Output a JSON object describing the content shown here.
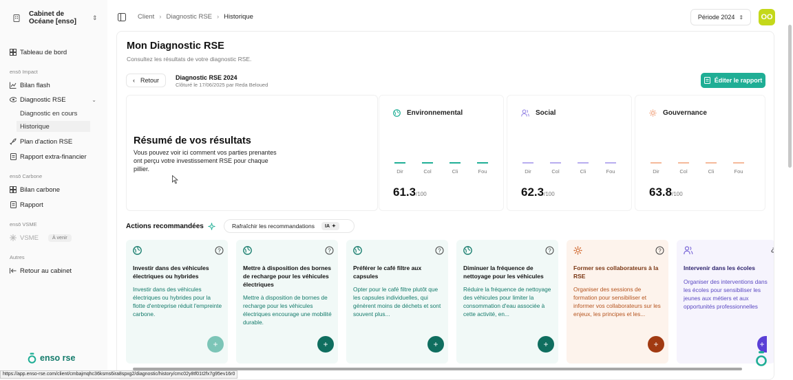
{
  "sidebar": {
    "org_name": "Cabinet de Océane [enso]",
    "items": {
      "tableau": "Tableau de bord",
      "group_impact": "ensō Impact",
      "bilan_flash": "Bilan flash",
      "diagnostic": "Diagnostic RSE",
      "diagnostic_en_cours": "Diagnostic en cours",
      "historique": "Historique",
      "plan_action": "Plan d'action RSE",
      "rapport_extra": "Rapport extra-financier",
      "group_carbone": "ensō Carbone",
      "bilan_carbone": "Bilan carbone",
      "rapport": "Rapport",
      "group_vsme": "ensō VSME",
      "vsme": "VSME",
      "a_venir": "À venir",
      "group_autres": "Autres",
      "retour_cabinet": "Retour au cabinet"
    },
    "logo_text": "enso rse"
  },
  "breadcrumb": [
    "Client",
    "Diagnostic RSE",
    "Historique"
  ],
  "period": "Période 2024",
  "avatar_initials": "OO",
  "page": {
    "title": "Mon Diagnostic RSE",
    "subtitle": "Consultez les résultats de votre diagnostic RSE.",
    "back_label": "Retour",
    "diag_title": "Diagnostic RSE 2024",
    "diag_meta": "Clôturé le 17/06/2025 par Reda Beloued",
    "edit_label": "Éditer le rapport"
  },
  "summary": {
    "title": "Résumé de vos résultats",
    "text": "Vous pouvez voir ici comment vos parties prenantes ont perçu votre investissement RSE pour chaque pillier."
  },
  "pillars": [
    {
      "name": "Environnemental",
      "score": "61.3",
      "max": "/100",
      "color": "#1fae95",
      "bar_labels": [
        "Dir",
        "Col",
        "Cli",
        "Fou"
      ]
    },
    {
      "name": "Social",
      "score": "62.3",
      "max": "/100",
      "color": "#9b8ce6",
      "bar_labels": [
        "Dir",
        "Col",
        "Cli",
        "Fou"
      ]
    },
    {
      "name": "Gouvernance",
      "score": "63.8",
      "max": "/100",
      "color": "#f0a07a",
      "bar_labels": [
        "Dir",
        "Col",
        "Cli",
        "Fou"
      ]
    }
  ],
  "actions": {
    "title": "Actions recommandées",
    "refresh_label": "Rafraîchir les recommandations",
    "ia_label": "IA",
    "cards": [
      {
        "title": "Investir dans des véhicules électriques ou hybrides",
        "desc": "Investir dans des véhicules électriques ou hybrides pour la flotte d'entreprise réduit l'empreinte carbone.",
        "plus": "+"
      },
      {
        "title": "Mettre à disposition des bornes de recharge pour les véhicules électriques",
        "desc": "Mettre à disposition de bornes de recharge pour les véhicules électriques encourage une mobilité durable.",
        "plus": "+"
      },
      {
        "title": "Préférer le café filtre aux capsules",
        "desc": "Opter pour le café filtre plutôt que les capsules individuelles, qui génèrent moins de déchets et sont souvent plus...",
        "plus": "+"
      },
      {
        "title": "Diminuer la fréquence de nettoyage pour les véhicules",
        "desc": "Réduire la fréquence de nettoyage des véhicules pour limiter la consommation d'eau associée à cette activité, en...",
        "plus": "+"
      },
      {
        "title": "Former ses collaborateurs à la RSE",
        "desc": "Organiser des sessions de formation pour sensibiliser et informer vos collaborateurs sur les enjeux, les principes et les...",
        "plus": "+"
      },
      {
        "title": "Intervenir dans les écoles",
        "desc": "Organiser des interventions dans les écoles pour sensibiliser les jeunes aux métiers et aux opportunités professionnelles",
        "plus": "+"
      }
    ]
  },
  "status_url": "https://app.enso-rse.com/client/cmbajmqhc36ksms6ira8spxg2/diagnostic/history/cmc02y8tf01t2fx7g95ev16r0"
}
